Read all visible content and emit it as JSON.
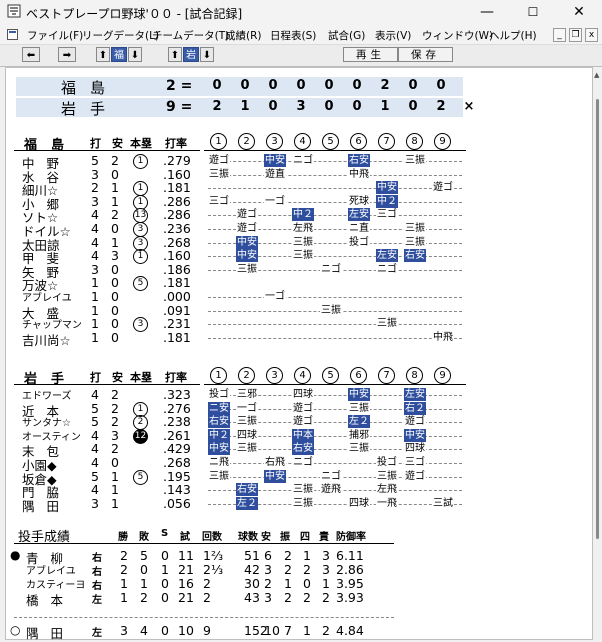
{
  "window": {
    "title": "ベストプレープロ野球'００ - [試合記録]",
    "minimize": "—",
    "maximize": "☐",
    "close": "✕"
  },
  "menu": [
    "ファイル(F)",
    "リーグデータ(L)",
    "チームデータ(T)",
    "成績(R)",
    "日程表(S)",
    "試合(G)",
    "表示(V)",
    "ウィンドウ(W)",
    "ヘルプ(H)"
  ],
  "mdi": {
    "min": "_",
    "restore": "❐",
    "close": "x"
  },
  "toolbar": {
    "team_a": "福",
    "team_b": "岩",
    "play_label": "再生",
    "save_label": "保存"
  },
  "scoreboard": {
    "home": {
      "name": "福島",
      "total": "2 =",
      "innings": [
        "0",
        "0",
        "0",
        "0",
        "0",
        "0",
        "2",
        "0",
        "0"
      ]
    },
    "away": {
      "name": "岩手",
      "total": "9 =",
      "innings": [
        "2",
        "1",
        "0",
        "3",
        "0",
        "0",
        "1",
        "0",
        "2"
      ],
      "last": "×"
    }
  },
  "batting_headers": {
    "col_at": "打",
    "col_hit": "安",
    "col_hr": "本塁",
    "col_avg": "打率",
    "innings": [
      "1",
      "2",
      "3",
      "4",
      "5",
      "6",
      "7",
      "8",
      "9"
    ]
  },
  "fukushima": {
    "team": "福島",
    "rows": [
      {
        "name": "中野",
        "ab": "5",
        "h": "2",
        "hr": "1",
        "avg": ".279",
        "pa": [
          [
            "遊ゴ",
            0
          ],
          [
            "",
            0
          ],
          [
            "中安",
            1
          ],
          [
            "ニゴ",
            0
          ],
          [
            "",
            0
          ],
          [
            "右安",
            1
          ],
          [
            "",
            0
          ],
          [
            "三振",
            0
          ],
          [
            "",
            0
          ]
        ]
      },
      {
        "name": "水谷",
        "ab": "3",
        "h": "0",
        "hr": "",
        "avg": ".160",
        "pa": [
          [
            "三振",
            0
          ],
          [
            "",
            0
          ],
          [
            "遊直",
            0
          ],
          [
            "",
            0
          ],
          [
            "",
            0
          ],
          [
            "中飛",
            0
          ],
          [
            "",
            0
          ],
          [
            "",
            0
          ],
          [
            "",
            0
          ]
        ]
      },
      {
        "name": "細川☆",
        "ab": "2",
        "h": "1",
        "hr": "1",
        "avg": ".181",
        "pa": [
          [
            "",
            0
          ],
          [
            "",
            0
          ],
          [
            "",
            0
          ],
          [
            "",
            0
          ],
          [
            "",
            0
          ],
          [
            "",
            0
          ],
          [
            "中安",
            1
          ],
          [
            "",
            0
          ],
          [
            "遊ゴ",
            0
          ]
        ]
      },
      {
        "name": "小郷",
        "ab": "3",
        "h": "1",
        "hr": "1",
        "avg": ".286",
        "pa": [
          [
            "三ゴ",
            0
          ],
          [
            "",
            0
          ],
          [
            "一ゴ",
            0
          ],
          [
            "",
            0
          ],
          [
            "",
            0
          ],
          [
            "死球",
            0
          ],
          [
            "中２",
            1
          ],
          [
            "",
            0
          ],
          [
            "",
            0
          ]
        ]
      },
      {
        "name": "ソト☆",
        "ab": "4",
        "h": "2",
        "hr": "13",
        "avg": ".286",
        "pa": [
          [
            "",
            0
          ],
          [
            "遊ゴ",
            0
          ],
          [
            "",
            0
          ],
          [
            "中２",
            1
          ],
          [
            "",
            0
          ],
          [
            "左安",
            1
          ],
          [
            "三ゴ",
            0
          ],
          [
            "",
            0
          ],
          [
            "",
            0
          ]
        ]
      },
      {
        "name": "ドイル☆",
        "ab": "4",
        "h": "0",
        "hr": "3",
        "avg": ".236",
        "pa": [
          [
            "",
            0
          ],
          [
            "遊ゴ",
            0
          ],
          [
            "",
            0
          ],
          [
            "左飛",
            0
          ],
          [
            "",
            0
          ],
          [
            "ニ直",
            0
          ],
          [
            "",
            0
          ],
          [
            "三振",
            0
          ],
          [
            "",
            0
          ]
        ]
      },
      {
        "name": "太田諒",
        "ab": "4",
        "h": "1",
        "hr": "3",
        "avg": ".268",
        "pa": [
          [
            "",
            0
          ],
          [
            "中安",
            1
          ],
          [
            "",
            0
          ],
          [
            "三振",
            0
          ],
          [
            "",
            0
          ],
          [
            "投ゴ",
            0
          ],
          [
            "",
            0
          ],
          [
            "三振",
            0
          ],
          [
            "",
            0
          ]
        ]
      },
      {
        "name": "甲斐",
        "ab": "4",
        "h": "3",
        "hr": "1",
        "avg": ".160",
        "pa": [
          [
            "",
            0
          ],
          [
            "中安",
            1
          ],
          [
            "",
            0
          ],
          [
            "三振",
            0
          ],
          [
            "",
            0
          ],
          [
            "",
            0
          ],
          [
            "左安",
            1
          ],
          [
            "右安",
            1
          ],
          [
            "",
            0
          ]
        ]
      },
      {
        "name": "矢野",
        "ab": "3",
        "h": "0",
        "hr": "",
        "avg": ".186",
        "pa": [
          [
            "",
            0
          ],
          [
            "三振",
            0
          ],
          [
            "",
            0
          ],
          [
            "",
            0
          ],
          [
            "ニゴ",
            0
          ],
          [
            "",
            0
          ],
          [
            "ニゴ",
            0
          ],
          [
            "",
            0
          ],
          [
            "",
            0
          ]
        ]
      },
      {
        "name": "万波☆",
        "ab": "1",
        "h": "0",
        "hr": "5",
        "avg": ".181",
        "pa": [
          [
            "",
            0
          ],
          [
            "",
            0
          ],
          [
            "",
            0
          ],
          [
            "",
            0
          ],
          [
            "",
            0
          ],
          [
            "",
            0
          ],
          [
            "",
            0
          ],
          [
            "",
            0
          ],
          [
            "",
            0
          ]
        ]
      },
      {
        "name": "アブレイユ",
        "ab": "1",
        "h": "0",
        "hr": "",
        "avg": ".000",
        "pa": [
          [
            "",
            0
          ],
          [
            "",
            0
          ],
          [
            "一ゴ",
            0
          ],
          [
            "",
            0
          ],
          [
            "",
            0
          ],
          [
            "",
            0
          ],
          [
            "",
            0
          ],
          [
            "",
            0
          ],
          [
            "",
            0
          ]
        ]
      },
      {
        "name": "大盛",
        "ab": "1",
        "h": "0",
        "hr": "",
        "avg": ".091",
        "pa": [
          [
            "",
            0
          ],
          [
            "",
            0
          ],
          [
            "",
            0
          ],
          [
            "",
            0
          ],
          [
            "三振",
            0
          ],
          [
            "",
            0
          ],
          [
            "",
            0
          ],
          [
            "",
            0
          ],
          [
            "",
            0
          ]
        ]
      },
      {
        "name": "チャップマン",
        "ab": "1",
        "h": "0",
        "hr": "3",
        "avg": ".231",
        "pa": [
          [
            "",
            0
          ],
          [
            "",
            0
          ],
          [
            "",
            0
          ],
          [
            "",
            0
          ],
          [
            "",
            0
          ],
          [
            "",
            0
          ],
          [
            "三振",
            0
          ],
          [
            "",
            0
          ],
          [
            "",
            0
          ]
        ]
      },
      {
        "name": "吉川尚☆",
        "ab": "1",
        "h": "0",
        "hr": "",
        "avg": ".181",
        "pa": [
          [
            "",
            0
          ],
          [
            "",
            0
          ],
          [
            "",
            0
          ],
          [
            "",
            0
          ],
          [
            "",
            0
          ],
          [
            "",
            0
          ],
          [
            "",
            0
          ],
          [
            "",
            0
          ],
          [
            "中飛",
            0
          ]
        ]
      }
    ]
  },
  "iwate": {
    "team": "岩手",
    "rows": [
      {
        "name": "エドワーズ",
        "ab": "4",
        "h": "2",
        "hr": "",
        "avg": ".323",
        "pa": [
          [
            "投ゴ",
            0
          ],
          [
            "三邪",
            0
          ],
          [
            "",
            0
          ],
          [
            "四球",
            0
          ],
          [
            "",
            0
          ],
          [
            "中安",
            1
          ],
          [
            "",
            0
          ],
          [
            "左安",
            1
          ],
          [
            "",
            0
          ]
        ]
      },
      {
        "name": "近本",
        "ab": "5",
        "h": "2",
        "hr": "1",
        "avg": ".276",
        "pa": [
          [
            "ニ安",
            1
          ],
          [
            "一ゴ",
            0
          ],
          [
            "",
            0
          ],
          [
            "遊ゴ",
            0
          ],
          [
            "",
            0
          ],
          [
            "三振",
            0
          ],
          [
            "",
            0
          ],
          [
            "右２",
            1
          ],
          [
            "",
            0
          ]
        ]
      },
      {
        "name": "サンタナ☆",
        "ab": "5",
        "h": "2",
        "hr": "2",
        "avg": ".238",
        "pa": [
          [
            "右安",
            1
          ],
          [
            "三振",
            0
          ],
          [
            "",
            0
          ],
          [
            "遊ゴ",
            0
          ],
          [
            "",
            0
          ],
          [
            "左２",
            1
          ],
          [
            "",
            0
          ],
          [
            "遊ゴ",
            0
          ],
          [
            "",
            0
          ]
        ]
      },
      {
        "name": "オースティン",
        "ab": "4",
        "h": "3",
        "hr": "12",
        "avg": ".261",
        "pa": [
          [
            "中２",
            1
          ],
          [
            "四球",
            0
          ],
          [
            "",
            0
          ],
          [
            "中本",
            1
          ],
          [
            "",
            0
          ],
          [
            "捕邪",
            0
          ],
          [
            "",
            0
          ],
          [
            "中安",
            1
          ],
          [
            "",
            0
          ]
        ]
      },
      {
        "name": "末包",
        "ab": "4",
        "h": "2",
        "hr": "",
        "avg": ".429",
        "pa": [
          [
            "中安",
            1
          ],
          [
            "三振",
            0
          ],
          [
            "",
            0
          ],
          [
            "右安",
            1
          ],
          [
            "",
            0
          ],
          [
            "三振",
            0
          ],
          [
            "",
            0
          ],
          [
            "四球",
            0
          ],
          [
            "",
            0
          ]
        ]
      },
      {
        "name": "小園◆",
        "ab": "4",
        "h": "0",
        "hr": "",
        "avg": ".268",
        "pa": [
          [
            "ニ飛",
            0
          ],
          [
            "",
            0
          ],
          [
            "右飛",
            0
          ],
          [
            "ニゴ",
            0
          ],
          [
            "",
            0
          ],
          [
            "",
            0
          ],
          [
            "投ゴ",
            0
          ],
          [
            "三ゴ",
            0
          ],
          [
            "",
            0
          ]
        ]
      },
      {
        "name": "坂倉◆",
        "ab": "5",
        "h": "1",
        "hr": "5",
        "avg": ".195",
        "pa": [
          [
            "三振",
            0
          ],
          [
            "",
            0
          ],
          [
            "中安",
            1
          ],
          [
            "",
            0
          ],
          [
            "ニゴ",
            0
          ],
          [
            "",
            0
          ],
          [
            "三振",
            0
          ],
          [
            "遊ゴ",
            0
          ],
          [
            "",
            0
          ]
        ]
      },
      {
        "name": "門脇",
        "ab": "4",
        "h": "1",
        "hr": "",
        "avg": ".143",
        "pa": [
          [
            "",
            0
          ],
          [
            "右安",
            1
          ],
          [
            "",
            0
          ],
          [
            "三振",
            0
          ],
          [
            "遊飛",
            0
          ],
          [
            "",
            0
          ],
          [
            "左飛",
            0
          ],
          [
            "",
            0
          ],
          [
            "",
            0
          ]
        ]
      },
      {
        "name": "隅田",
        "ab": "3",
        "h": "1",
        "hr": "",
        "avg": ".056",
        "pa": [
          [
            "",
            0
          ],
          [
            "左２",
            1
          ],
          [
            "",
            0
          ],
          [
            "三振",
            0
          ],
          [
            "",
            0
          ],
          [
            "四球",
            0
          ],
          [
            "一飛",
            0
          ],
          [
            "",
            0
          ],
          [
            "三試",
            0
          ]
        ]
      }
    ]
  },
  "pitching": {
    "title": "投手成績",
    "headers": [
      "勝",
      "敗",
      "S",
      "試",
      "回数",
      "球数",
      "安",
      "振",
      "四",
      "責",
      "防御率"
    ],
    "rows": [
      {
        "mark": "●",
        "name": "青柳",
        "hand": "右",
        "w": "2",
        "l": "5",
        "s": "0",
        "g": "11",
        "ip": "1⅔",
        "pitches": "51",
        "h": "6",
        "so": "2",
        "bb": "1",
        "er": "3",
        "era": "6.11"
      },
      {
        "mark": "",
        "name": "アブレイユ",
        "hand": "右",
        "w": "2",
        "l": "0",
        "s": "1",
        "g": "21",
        "ip": "2⅓",
        "pitches": "42",
        "h": "3",
        "so": "2",
        "bb": "2",
        "er": "3",
        "era": "2.86"
      },
      {
        "mark": "",
        "name": "カスティーヨ",
        "hand": "右",
        "w": "1",
        "l": "1",
        "s": "0",
        "g": "16",
        "ip": "2",
        "pitches": "30",
        "h": "2",
        "so": "1",
        "bb": "0",
        "er": "1",
        "era": "3.95"
      },
      {
        "mark": "",
        "name": "橋本",
        "hand": "左",
        "w": "1",
        "l": "2",
        "s": "0",
        "g": "21",
        "ip": "2",
        "pitches": "43",
        "h": "3",
        "so": "2",
        "bb": "2",
        "er": "2",
        "era": "3.93"
      },
      {
        "mark": "○",
        "name": "隅田",
        "hand": "左",
        "w": "3",
        "l": "4",
        "s": "0",
        "g": "10",
        "ip": "9",
        "pitches": "152",
        "h": "10",
        "so": "7",
        "bb": "1",
        "er": "2",
        "era": "4.84"
      }
    ]
  }
}
